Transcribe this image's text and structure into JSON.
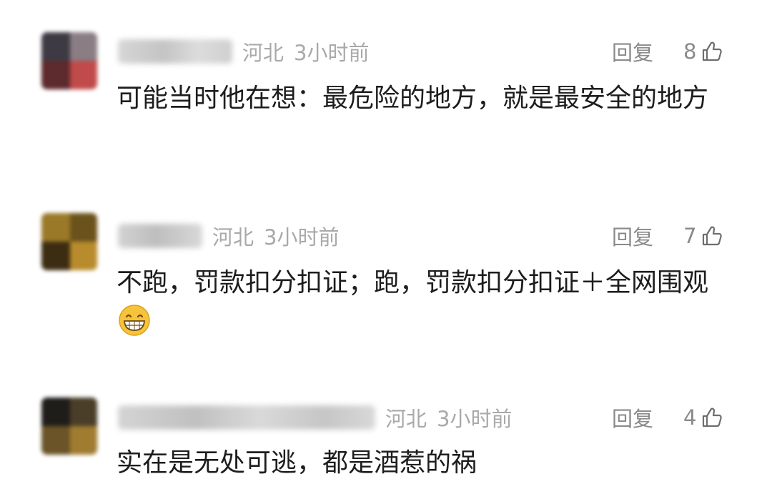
{
  "comments": [
    {
      "region": "河北",
      "time": "3小时前",
      "reply_label": "回复",
      "likes": "8",
      "text": "可能当时他在想：最危险的地方，就是最安全的地方",
      "username_blurred": true
    },
    {
      "region": "河北",
      "time": "3小时前",
      "reply_label": "回复",
      "likes": "7",
      "text": "不跑，罚款扣分扣证；跑，罚款扣分扣证＋全网围观",
      "emoji": "grinning-face-emoji",
      "username_blurred": true
    },
    {
      "region": "河北",
      "time": "3小时前",
      "reply_label": "回复",
      "likes": "4",
      "text": "实在是无处可逃，都是酒惹的祸",
      "username_blurred": true
    }
  ],
  "icons": {
    "like": "thumbs-up-icon"
  },
  "colors": {
    "meta": "#a9a9a9",
    "action": "#8a8a8a",
    "text": "#1d1d1d",
    "emoji": "#f6c33b"
  }
}
